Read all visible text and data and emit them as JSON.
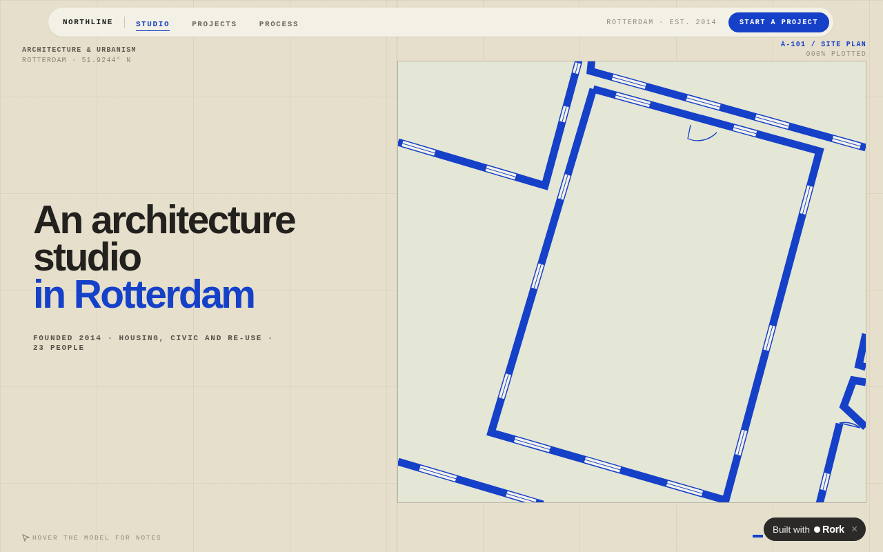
{
  "nav": {
    "brand": "NORTHLINE",
    "links": [
      {
        "label": "STUDIO",
        "selected": true
      },
      {
        "label": "PROJECTS",
        "selected": false
      },
      {
        "label": "PROCESS",
        "selected": false
      }
    ],
    "meta": "ROTTERDAM · EST. 2014",
    "cta": "START A PROJECT"
  },
  "intro": {
    "discipline": "ARCHITECTURE & URBANISM",
    "coordinates": "ROTTERDAM · 51.9244° N"
  },
  "hero": {
    "title_lines": [
      "An architecture",
      "studio"
    ],
    "title_accent": "in Rotterdam",
    "subtitle": "FOUNDED 2014 · HOUSING, CIVIC AND RE-USE · 23 PEOPLE"
  },
  "plan": {
    "sheet": "A-101 / SITE PLAN",
    "status": "000% PLOTTED"
  },
  "hint": "HOVER THE MODEL FOR NOTES",
  "badge": {
    "label": "Built with",
    "brand": "Rork",
    "close": "×"
  }
}
